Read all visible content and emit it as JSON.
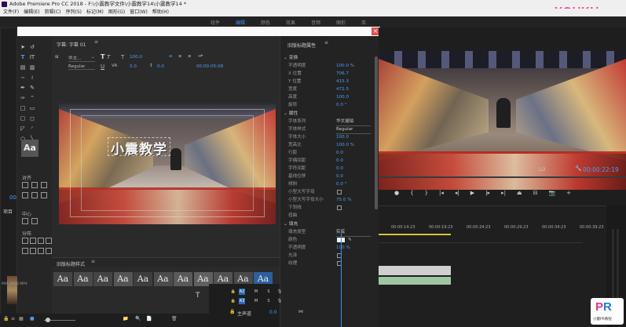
{
  "app": {
    "title": "Adobe Premiere Pro CC 2018 - F:\\小震教学文件\\小震教学14\\小震教学14 *",
    "watermark": "YOUKU"
  },
  "menu": [
    "文件(F)",
    "编辑(E)",
    "剪辑(C)",
    "序列(S)",
    "标记(M)",
    "图形(G)",
    "窗口(W)",
    "帮助(H)"
  ],
  "workspaces": {
    "items": [
      "组件",
      "编辑",
      "颜色",
      "效果",
      "音频",
      "图形",
      "库"
    ],
    "active_index": 1
  },
  "titler": {
    "panel_title": "字幕: 字幕 01",
    "font_family": "华文...",
    "font_style": "Regular",
    "font_size": "100.0",
    "tracking": "0.0",
    "leading": "0.0",
    "timecode": "00:00:05:08",
    "overlay_text": "小震教学",
    "styles_title": "旧版标题样式",
    "style_sample": "Aa",
    "action_section": "对齐",
    "center_section": "中心",
    "distribute_section": "分布",
    "project_tab": "项目",
    "clip_names": [
      "MVI_8986.MP4",
      "MVI_898..."
    ]
  },
  "properties": {
    "title": "旧版标题属性",
    "transform_section": "变换",
    "opacity_label": "不透明度",
    "opacity_value": "100.0 %",
    "x_label": "X 位置",
    "x_value": "706.7",
    "y_label": "Y 位置",
    "y_value": "415.3",
    "width_label": "宽度",
    "width_value": "472.5",
    "height_label": "高度",
    "height_value": "100.0",
    "rotation_label": "旋转",
    "rotation_value": "0.0 °",
    "attributes_section": "属性",
    "font_family_label": "字体系列",
    "font_family_value": "华文琥珀",
    "font_style_label": "字体样式",
    "font_style_value": "Regular",
    "font_size_label": "字体大小",
    "font_size_value": "100.0",
    "aspect_label": "宽高比",
    "aspect_value": "100.0 %",
    "leading_label": "行距",
    "leading_value": "0.0",
    "kerning_label": "字偶间距",
    "kerning_value": "0.0",
    "tracking_label": "字符间距",
    "tracking_value": "0.0",
    "baseline_label": "基线位移",
    "baseline_value": "0.0",
    "slant_label": "倾斜",
    "slant_value": "0.0 °",
    "smallcaps_label": "小型大写字母",
    "smallcaps_size_label": "小型大写字母大小",
    "smallcaps_size_value": "75.0 %",
    "underline_label": "下划线",
    "distort_label": "扭曲",
    "fill_section": "填充",
    "fill_type_label": "填充类型",
    "fill_type_value": "实底",
    "color_label": "颜色",
    "fill_opacity_label": "不透明度",
    "fill_opacity_value": "100 %",
    "sheen_label": "光泽",
    "texture_label": "纹理"
  },
  "program": {
    "timecode": "00:00:22:19",
    "zoom": "1/2",
    "left_timecode": "00:0"
  },
  "timeline": {
    "ruler": [
      "00:00:14:23",
      "00:00:19:23",
      "00:00:24:23",
      "00:00:29:23",
      "00:00:34:23",
      "00:00:39:23"
    ],
    "tracks": [
      {
        "name": "A2",
        "m": "M",
        "s": "S"
      },
      {
        "name": "A3",
        "m": "M",
        "s": "S"
      }
    ],
    "master_label": "主声道",
    "master_value": "0.0"
  },
  "logo": {
    "caption": "小震PR教程"
  },
  "colors": {
    "accent_blue": "#4d9cf0",
    "title_red": "#d9534f",
    "playhead": "#3b8ee6",
    "yellow_bar": "#d8c13a"
  }
}
